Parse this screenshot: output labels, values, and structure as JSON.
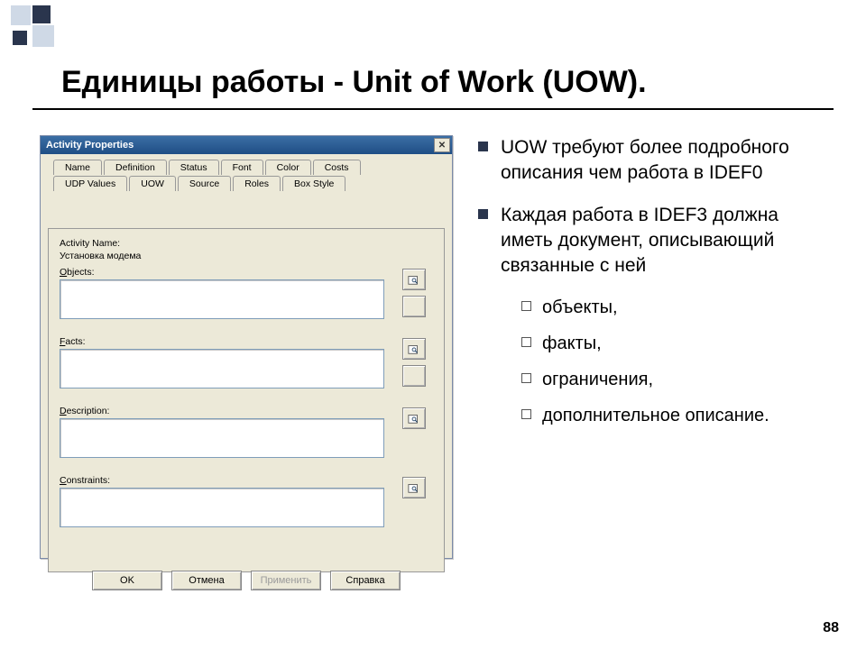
{
  "slide": {
    "title": "Единицы работы - Unit of Work (UOW).",
    "page_number": "88"
  },
  "bullets": {
    "b1": "UOW требуют более подробного описания чем работа в IDEF0",
    "b2": "Каждая работа в IDEF3 должна иметь документ, описывающий связанные с ней",
    "sub1": "объекты,",
    "sub2": "факты,",
    "sub3": "ограничения,",
    "sub4": "дополнительное описание."
  },
  "dialog": {
    "title": "Activity Properties",
    "close": "✕",
    "tabs_row1": {
      "name": "Name",
      "definition": "Definition",
      "status": "Status",
      "font": "Font",
      "color": "Color",
      "costs": "Costs"
    },
    "tabs_row2": {
      "udp": "UDP Values",
      "uow": "UOW",
      "source": "Source",
      "roles": "Roles",
      "box": "Box Style"
    },
    "labels": {
      "activity_name": "Activity Name:",
      "activity_value": "Установка модема",
      "objects": "Objects:",
      "facts": "Facts:",
      "description": "Description:",
      "constraints": "Constraints:"
    },
    "buttons": {
      "ok": "OK",
      "cancel": "Отмена",
      "apply": "Применить",
      "help": "Справка"
    }
  }
}
